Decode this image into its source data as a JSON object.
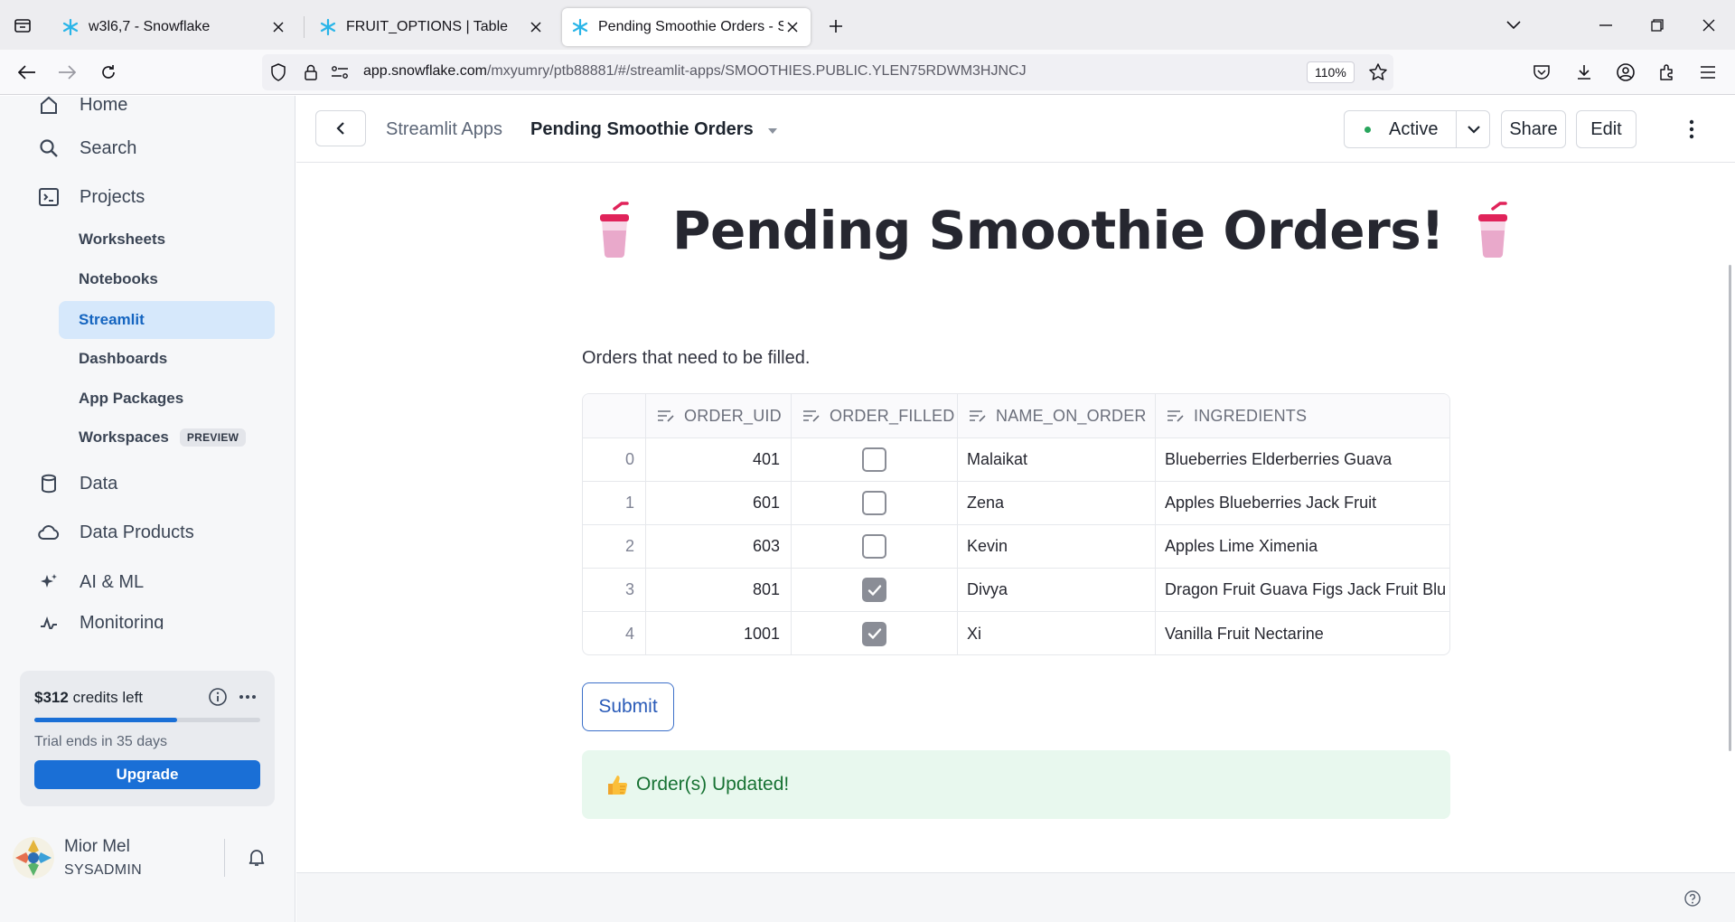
{
  "browser": {
    "tabs": [
      {
        "title": "w3l6,7 - Snowflake",
        "active": false
      },
      {
        "title": "FRUIT_OPTIONS | Table",
        "active": false
      },
      {
        "title": "Pending Smoothie Orders - Snowflake",
        "active": true
      }
    ],
    "url_host": "app.snowflake.com",
    "url_path": "/mxyumry/ptb88881/#/streamlit-apps/SMOOTHIES.PUBLIC.YLEN75RDWM3HJNCJ",
    "zoom": "110%"
  },
  "sidebar": {
    "main_items": [
      {
        "label": "Home",
        "icon": "home-icon"
      },
      {
        "label": "Search",
        "icon": "search-icon"
      },
      {
        "label": "Projects",
        "icon": "terminal-icon"
      },
      {
        "label": "Data",
        "icon": "database-icon"
      },
      {
        "label": "Data Products",
        "icon": "cloud-icon"
      },
      {
        "label": "AI & ML",
        "icon": "sparkle-icon"
      },
      {
        "label": "Monitoring",
        "icon": "activity-icon"
      }
    ],
    "project_items": [
      {
        "label": "Worksheets"
      },
      {
        "label": "Notebooks"
      },
      {
        "label": "Streamlit"
      },
      {
        "label": "Dashboards"
      },
      {
        "label": "App Packages"
      },
      {
        "label": "Workspaces",
        "badge": "PREVIEW"
      }
    ],
    "credits": {
      "amount": "$312",
      "suffix": "credits left",
      "progress_fraction": 0.63,
      "trial_text": "Trial ends in 35 days",
      "upgrade_label": "Upgrade"
    },
    "user": {
      "name": "Mior Mel",
      "role": "SYSADMIN"
    }
  },
  "header": {
    "breadcrumb_parent": "Streamlit Apps",
    "breadcrumb_current": "Pending Smoothie Orders",
    "status_label": "Active",
    "share_label": "Share",
    "edit_label": "Edit"
  },
  "app": {
    "title": "Pending Smoothie Orders!",
    "caption": "Orders that need to be filled.",
    "columns": [
      "ORDER_UID",
      "ORDER_FILLED",
      "NAME_ON_ORDER",
      "INGREDIENTS"
    ],
    "rows": [
      {
        "index": "0",
        "uid": "401",
        "filled": false,
        "name": "Malaikat",
        "ingredients": "Blueberries Elderberries Guava"
      },
      {
        "index": "1",
        "uid": "601",
        "filled": false,
        "name": "Zena",
        "ingredients": "Apples Blueberries Jack Fruit"
      },
      {
        "index": "2",
        "uid": "603",
        "filled": false,
        "name": "Kevin",
        "ingredients": "Apples Lime Ximenia"
      },
      {
        "index": "3",
        "uid": "801",
        "filled": true,
        "name": "Divya",
        "ingredients": "Dragon Fruit Guava Figs Jack Fruit Blu"
      },
      {
        "index": "4",
        "uid": "1001",
        "filled": true,
        "name": "Xi",
        "ingredients": "Vanilla Fruit Nectarine"
      }
    ],
    "submit_label": "Submit",
    "success_message": "Order(s) Updated!"
  },
  "colors": {
    "accent": "#1a6fd6",
    "active_nav_bg": "#d6e8fb",
    "status_active": "#28a55c",
    "success_bg": "#e8f8ee",
    "success_text": "#177233"
  }
}
